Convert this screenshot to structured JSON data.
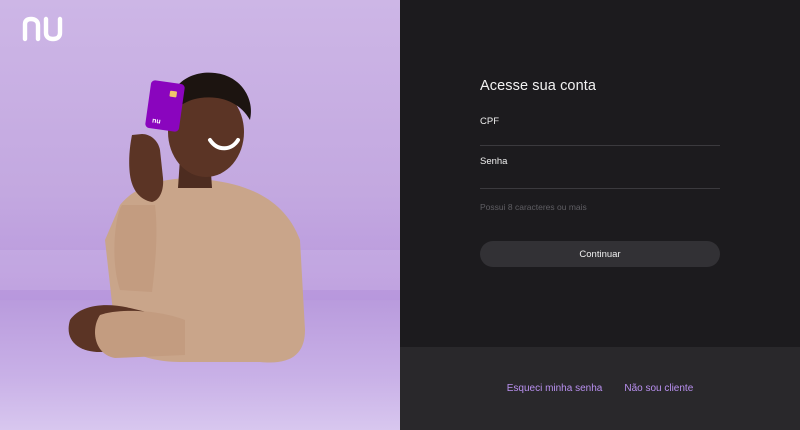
{
  "brand": {
    "logo_text": "nu",
    "accent": "#8a05be",
    "link_color": "#b990f0"
  },
  "hero": {
    "card_logo_text": "nu"
  },
  "login": {
    "title": "Acesse sua conta",
    "cpf_label": "CPF",
    "password_label": "Senha",
    "password_hint": "Possui 8 caracteres ou mais",
    "continue_label": "Continuar"
  },
  "footer": {
    "forgot_password": "Esqueci minha senha",
    "not_customer": "Não sou cliente"
  }
}
